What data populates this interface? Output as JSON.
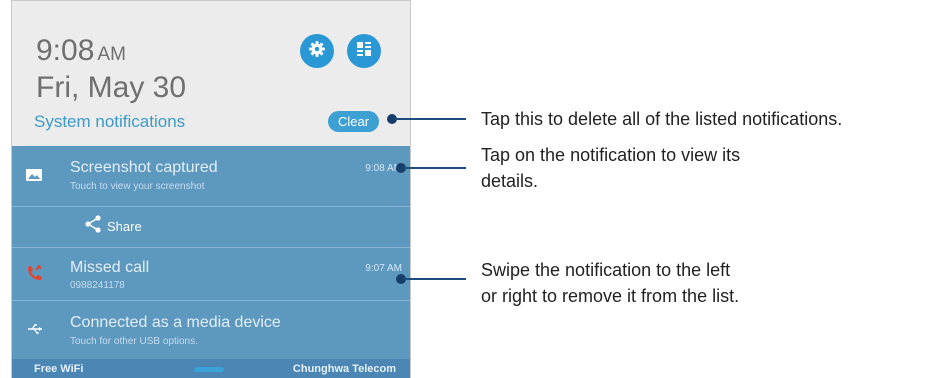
{
  "header": {
    "time": "9:08",
    "ampm": "AM",
    "date": "Fri, May 30",
    "system_notifications": "System notifications",
    "clear_label": "Clear"
  },
  "notifications": [
    {
      "title": "Screenshot captured",
      "subtitle": "Touch to view your screenshot",
      "time": "9:08 AM",
      "action": "Share"
    },
    {
      "title": "Missed call",
      "subtitle": "0988241178",
      "time": "9:07 AM"
    },
    {
      "title": "Connected as a media device",
      "subtitle": "Touch for other USB options."
    }
  ],
  "statusbar": {
    "left": "Free WiFi",
    "right": "Chunghwa Telecom"
  },
  "annotations": {
    "clear": "Tap this to delete all of the listed notifications.",
    "view_line1": "Tap on the notification to view its",
    "view_line2": "details.",
    "swipe_line1": "Swipe the notification to the left",
    "swipe_line2": "or right to remove it from the list."
  },
  "colors": {
    "header_bg": "#ececec",
    "panel_bg": "#5d98bf",
    "accent": "#2a98d5",
    "callout_line": "#1e4d7d",
    "missed_call_icon": "#e8412c"
  },
  "icons": [
    "settings-icon",
    "quick-settings-icon",
    "image-icon",
    "share-icon",
    "missed-call-icon",
    "usb-icon"
  ]
}
